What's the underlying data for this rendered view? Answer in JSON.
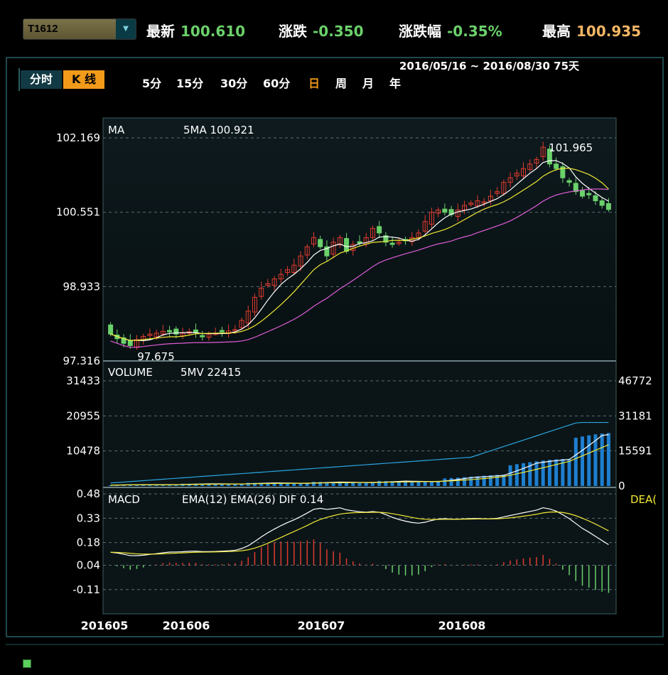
{
  "header": {
    "symbol": "T1612",
    "latest_label": "最新",
    "latest_value": "100.610",
    "change_label": "涨跌",
    "change_value": "-0.350",
    "change_pct_label": "涨跌幅",
    "change_pct_value": "-0.35%",
    "high_label": "最高",
    "high_value": "100.935"
  },
  "tabs": {
    "fenshi": "分时",
    "kline": "K 线"
  },
  "periods": [
    "5分",
    "15分",
    "30分",
    "60分",
    "日",
    "周",
    "月",
    "年"
  ],
  "active_period": "日",
  "date_range": "2016/05/16 ~ 2016/08/30  75天",
  "colors": {
    "up": "#e03a2e",
    "down": "#6bd16b",
    "white_ma": "#ffffff",
    "yellow_ma": "#f2e833",
    "magenta_ma": "#e05cd8",
    "vol_ma": "#2aa6e0",
    "panel_border": "#1d4a4f"
  },
  "chart_data": [
    {
      "type": "candlestick",
      "label": "MA",
      "ma_label": "5MA 100.921",
      "y_ticks": [
        "102.169",
        "100.551",
        "98.933",
        "97.316"
      ],
      "ylim": [
        97.316,
        102.169
      ],
      "high_annotation": "101.965",
      "low_annotation": "97.675",
      "x_ticks": [
        "201605",
        "201606",
        "201607",
        "201608"
      ],
      "closes": [
        97.9,
        97.8,
        97.7,
        97.65,
        97.78,
        97.85,
        97.9,
        97.92,
        97.96,
        97.95,
        97.9,
        97.92,
        97.95,
        97.93,
        97.85,
        97.9,
        97.92,
        97.95,
        97.97,
        98.0,
        98.2,
        98.4,
        98.7,
        98.9,
        99.0,
        99.1,
        99.2,
        99.3,
        99.4,
        99.6,
        99.8,
        100.0,
        99.8,
        99.6,
        99.9,
        100.0,
        99.7,
        99.85,
        99.9,
        100.0,
        100.2,
        100.1,
        99.9,
        99.85,
        99.9,
        99.95,
        100.0,
        100.1,
        100.35,
        100.55,
        100.6,
        100.55,
        100.5,
        100.6,
        100.7,
        100.75,
        100.8,
        100.78,
        100.9,
        101.0,
        101.2,
        101.3,
        101.4,
        101.5,
        101.6,
        101.7,
        101.965,
        101.6,
        101.5,
        101.3,
        101.2,
        101.0,
        100.9,
        100.95,
        100.8,
        100.7,
        100.61
      ]
    },
    {
      "type": "bar",
      "label": "VOLUME",
      "ma_label": "5MV 22415",
      "y_ticks_left": [
        "31433",
        "20955",
        "10478"
      ],
      "y_ticks_right": [
        "46772",
        "31181",
        "15591",
        "0"
      ],
      "ylim": [
        0,
        31433
      ]
    },
    {
      "type": "bar",
      "label": "MACD",
      "ma_label": "EMA(12) EMA(26) DIF 0.14",
      "right_label": "DEA(",
      "y_ticks": [
        "0.48",
        "0.33",
        "0.18",
        "0.04",
        "-0.11"
      ],
      "ylim": [
        -0.26,
        0.52
      ]
    }
  ]
}
